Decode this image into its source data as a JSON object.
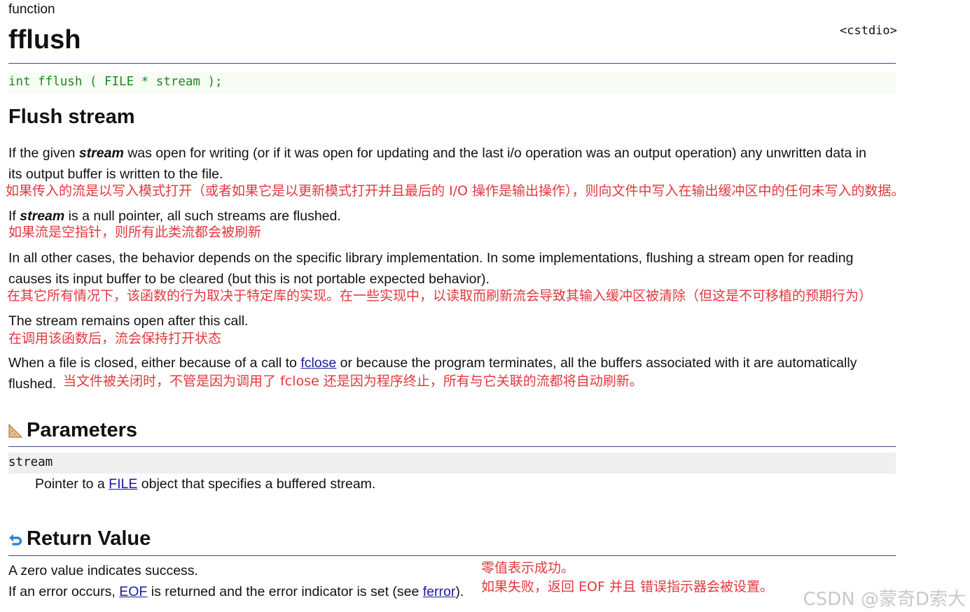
{
  "header": {
    "kind": "function",
    "title": "fflush",
    "header_file": "<cstdio>"
  },
  "prototype": "int fflush ( FILE * stream );",
  "section_title": "Flush stream",
  "paragraphs": {
    "p1_a": "If the given ",
    "p1_em": "stream",
    "p1_b": " was open for writing (or if it was open for updating and the last i/o operation was an output operation) any unwritten data in",
    "p1_line2": "its output buffer is written to the file.",
    "p1_cn": "如果传入的流是以写入模式打开（或者如果它是以更新模式打开并且最后的 I/O 操作是输出操作），则向文件中写入在输出缓冲区中的任何未写入的数据。",
    "p2_a": "If ",
    "p2_em": "stream",
    "p2_b": " is a null pointer, all such streams are flushed.",
    "p2_cn": "如果流是空指针，则所有此类流都会被刷新",
    "p3_line1": "In all other cases, the behavior depends on the specific library implementation. In some implementations, flushing a stream open for reading",
    "p3_line2": "causes its input buffer to be cleared (but this is not portable expected behavior).",
    "p3_cn": "在其它所有情况下，该函数的行为取决于特定库的实现。在一些实现中，以读取而刷新流会导致其输入缓冲区被清除（但这是不可移植的预期行为）",
    "p4": "The stream remains open after this call.",
    "p4_cn": "在调用该函数后，流会保持打开状态",
    "p5_a": "When a file is closed, either because of a call to ",
    "p5_link": "fclose",
    "p5_b": " or because the program terminates, all the buffers associated with it are automatically",
    "p5_line2": "flushed.",
    "p5_cn": "当文件被关闭时，不管是因为调用了 fclose 还是因为程序终止，所有与它关联的流都将自动刷新。"
  },
  "parameters": {
    "title": "Parameters",
    "name": "stream",
    "desc_a": "Pointer to a ",
    "desc_link": "FILE",
    "desc_b": " object that specifies a buffered stream."
  },
  "return_value": {
    "title": "Return Value",
    "line1": "A zero value indicates success.",
    "line2_a": "If an error occurs, ",
    "line2_link1": "EOF",
    "line2_b": " is returned and the error indicator is set (see ",
    "line2_link2": "ferror",
    "line2_c": ").",
    "cn_line1": "零值表示成功。",
    "cn_line2": "如果失败，返回 EOF 并且 错误指示器会被设置。"
  },
  "watermark": "CSDN @蒙奇D索大",
  "colors": {
    "annotation": "#e0383e",
    "link": "#1a1a9e",
    "prototype": "#1c8a1c",
    "rule": "#3c4a80"
  },
  "icons": {
    "parameters": "triangle-ruler-icon",
    "return_value": "return-arrow-icon"
  }
}
